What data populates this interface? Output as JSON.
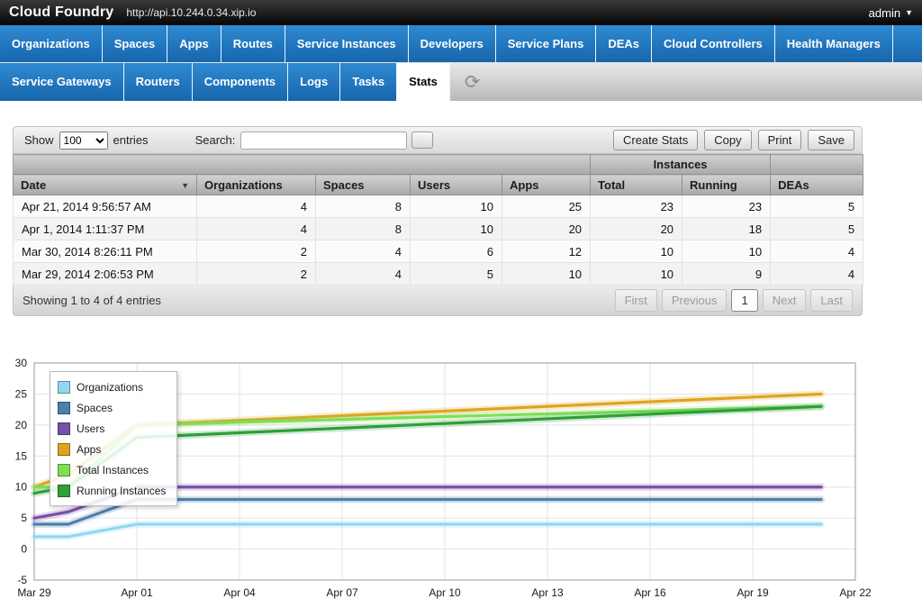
{
  "topbar": {
    "brand": "Cloud Foundry",
    "url": "http://api.10.244.0.34.xip.io",
    "user": "admin"
  },
  "nav": {
    "row1": [
      "Organizations",
      "Spaces",
      "Apps",
      "Routes",
      "Service Instances",
      "Developers",
      "Service Plans",
      "DEAs",
      "Cloud Controllers",
      "Health Managers"
    ],
    "row2": [
      "Service Gateways",
      "Routers",
      "Components",
      "Logs",
      "Tasks",
      "Stats"
    ],
    "active": "Stats"
  },
  "toolbar": {
    "show_label": "Show",
    "entries_value": "100",
    "entries_label": "entries",
    "search_label": "Search:",
    "buttons": [
      "Create Stats",
      "Copy",
      "Print",
      "Save"
    ]
  },
  "table": {
    "group_header": "Instances",
    "columns": [
      "Date",
      "Organizations",
      "Spaces",
      "Users",
      "Apps",
      "Total",
      "Running",
      "DEAs"
    ],
    "rows": [
      [
        "Apr 21, 2014 9:56:57 AM",
        "4",
        "8",
        "10",
        "25",
        "23",
        "23",
        "5"
      ],
      [
        "Apr 1, 2014 1:11:37 PM",
        "4",
        "8",
        "10",
        "20",
        "20",
        "18",
        "5"
      ],
      [
        "Mar 30, 2014 8:26:11 PM",
        "2",
        "4",
        "6",
        "12",
        "10",
        "10",
        "4"
      ],
      [
        "Mar 29, 2014 2:06:53 PM",
        "2",
        "4",
        "5",
        "10",
        "10",
        "9",
        "4"
      ]
    ],
    "footer": "Showing 1 to 4 of 4 entries",
    "pagination": {
      "first": "First",
      "previous": "Previous",
      "page": "1",
      "next": "Next",
      "last": "Last"
    }
  },
  "chart_data": {
    "type": "line",
    "x_ticks": [
      "Mar 29",
      "Apr 01",
      "Apr 04",
      "Apr 07",
      "Apr 10",
      "Apr 13",
      "Apr 16",
      "Apr 19",
      "Apr 22"
    ],
    "x_tick_days": [
      0,
      3,
      6,
      9,
      12,
      15,
      18,
      21,
      24
    ],
    "x_days": [
      0,
      1,
      3,
      23
    ],
    "x_range_days": [
      0,
      24
    ],
    "ylim": [
      -5,
      30
    ],
    "y_ticks": [
      -5,
      0,
      5,
      10,
      15,
      20,
      25,
      30
    ],
    "grid": true,
    "legend_position": "top-left",
    "series": [
      {
        "name": "Organizations",
        "color": "#92d7f0",
        "values": [
          2,
          2,
          4,
          4
        ]
      },
      {
        "name": "Spaces",
        "color": "#4d7fae",
        "values": [
          4,
          4,
          8,
          8
        ]
      },
      {
        "name": "Users",
        "color": "#7a4fa8",
        "values": [
          5,
          6,
          10,
          10
        ]
      },
      {
        "name": "Apps",
        "color": "#dfa41f",
        "values": [
          10,
          12,
          20,
          25
        ]
      },
      {
        "name": "Total Instances",
        "color": "#7fdf55",
        "values": [
          10,
          10,
          20,
          23
        ]
      },
      {
        "name": "Running Instances",
        "color": "#2f9e3b",
        "values": [
          9,
          10,
          18,
          23
        ]
      }
    ]
  }
}
